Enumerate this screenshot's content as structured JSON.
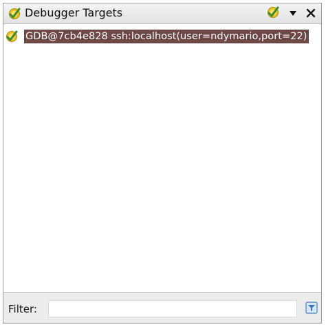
{
  "panel": {
    "title": "Debugger Targets",
    "title_icon": "debugger-target-icon",
    "toolbar": {
      "connect_icon": "connect-target-icon",
      "menu_icon": "dropdown-menu-icon",
      "close_icon": "close-icon"
    }
  },
  "targets": [
    {
      "label": "GDB@7cb4e828 ssh:localhost(user=ndymario,port=22)",
      "icon": "debugger-target-icon",
      "selected": true
    }
  ],
  "filter": {
    "label": "Filter:",
    "value": "",
    "button_icon": "filter-options-icon"
  },
  "colors": {
    "selection_bg": "#6e4747",
    "selection_fg": "#ffffff",
    "icon_green": "#3c8a2e",
    "icon_yellow": "#e8c21a"
  }
}
